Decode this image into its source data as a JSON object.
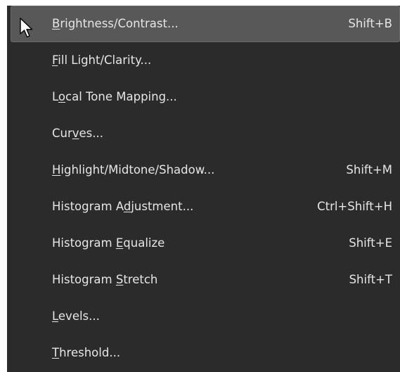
{
  "menu": {
    "items": [
      {
        "pre": "",
        "mnemonic": "B",
        "post": "rightness/Contrast...",
        "shortcut": "Shift+B",
        "highlighted": true
      },
      {
        "pre": "",
        "mnemonic": "F",
        "post": "ill Light/Clarity...",
        "shortcut": ""
      },
      {
        "pre": "L",
        "mnemonic": "o",
        "post": "cal Tone Mapping...",
        "shortcut": ""
      },
      {
        "pre": "Cur",
        "mnemonic": "v",
        "post": "es...",
        "shortcut": ""
      },
      {
        "pre": "",
        "mnemonic": "H",
        "post": "ighlight/Midtone/Shadow...",
        "shortcut": "Shift+M"
      },
      {
        "pre": "Histogram A",
        "mnemonic": "d",
        "post": "justment...",
        "shortcut": "Ctrl+Shift+H"
      },
      {
        "pre": "Histogram ",
        "mnemonic": "E",
        "post": "qualize",
        "shortcut": "Shift+E"
      },
      {
        "pre": "Histogram ",
        "mnemonic": "S",
        "post": "tretch",
        "shortcut": "Shift+T"
      },
      {
        "pre": "",
        "mnemonic": "L",
        "post": "evels...",
        "shortcut": ""
      },
      {
        "pre": "",
        "mnemonic": "T",
        "post": "hreshold...",
        "shortcut": ""
      }
    ]
  },
  "colors": {
    "menu_background": "#2b2b2b",
    "highlight_background": "#585858",
    "text": "#e6e6e6"
  },
  "cursor": {
    "icon": "mouse-pointer-icon"
  }
}
